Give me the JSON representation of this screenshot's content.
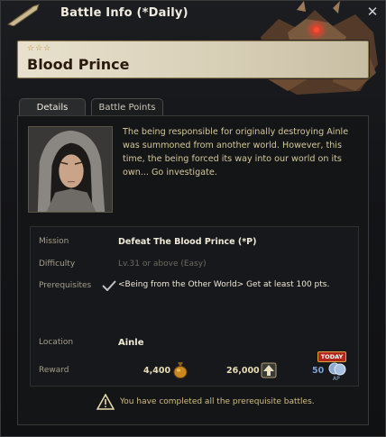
{
  "window": {
    "title": "Battle Info  (*Daily)"
  },
  "banner": {
    "stars": "☆☆☆",
    "boss_name": "Blood Prince"
  },
  "tabs": [
    {
      "label": "Details"
    },
    {
      "label": "Battle Points"
    }
  ],
  "description": "The being responsible for originally destroying Ainle was summoned from another world. However, this time, the being forced its way into our world on its own... Go investigate.",
  "info": {
    "mission_label": "Mission",
    "mission_value": "Defeat The Blood Prince (*P)",
    "difficulty_label": "Difficulty",
    "difficulty_value": "Lv.31 or above (Easy)",
    "prereq_label": "Prerequisites",
    "prereq_value": "<Being from the Other World> Get at least 100 pts.",
    "location_label": "Location",
    "location_value": "Ainle",
    "reward_label": "Reward",
    "reward_gold": "4,400",
    "reward_exp": "26,000",
    "reward_ap": "50",
    "ap_label": "AP",
    "today_badge": "TODAY"
  },
  "notice": "You have completed all the prerequisite battles.",
  "colors": {
    "accent_gold": "#d2be82",
    "banner_bg": "#e8e1cd",
    "today_red": "#b0281c"
  }
}
